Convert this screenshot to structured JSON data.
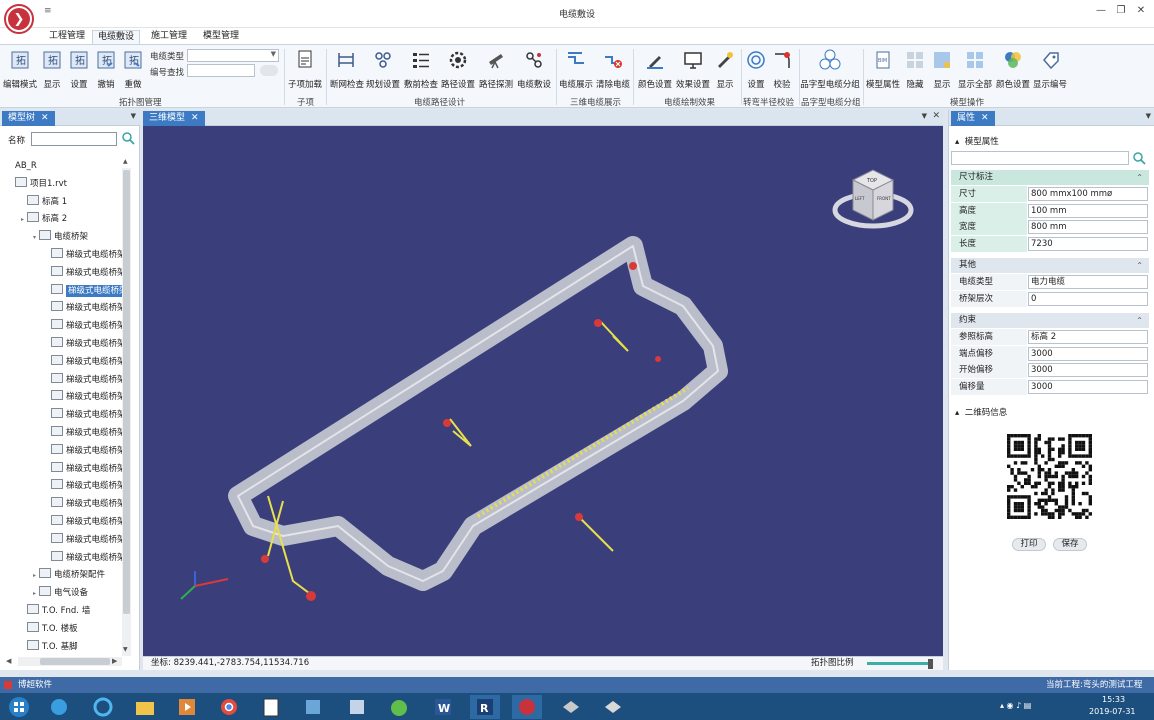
{
  "app": {
    "logo_glyph": "❯",
    "quick_access": "≡",
    "title": "电缆敷设",
    "window_controls": [
      "—",
      "❐",
      "✕"
    ]
  },
  "ribbon_tabs": [
    "工程管理",
    "电缆敷设",
    "施工管理",
    "模型管理"
  ],
  "ribbon": {
    "buttons": [
      {
        "id": "edit-mode",
        "label": "编辑模式",
        "icon": "topology-edit-icon"
      },
      {
        "id": "show",
        "label": "显示",
        "icon": "topology-show-icon"
      },
      {
        "id": "settings",
        "label": "设置",
        "icon": "topology-settings-icon"
      },
      {
        "id": "undo",
        "label": "撤销",
        "icon": "undo-icon"
      },
      {
        "id": "redo",
        "label": "重做",
        "icon": "redo-icon"
      },
      {
        "id": "sub-add",
        "label": "子项加载",
        "icon": "document-icon"
      },
      {
        "id": "break-check",
        "label": "断网检查",
        "icon": "network-break-icon"
      },
      {
        "id": "plan-settings",
        "label": "规划设置",
        "icon": "nodes-icon"
      },
      {
        "id": "lay-check",
        "label": "敷前检查",
        "icon": "checklist-icon"
      },
      {
        "id": "path-settings",
        "label": "路径设置",
        "icon": "path-gear-icon"
      },
      {
        "id": "path-probe",
        "label": "路径探测",
        "icon": "telescope-icon"
      },
      {
        "id": "cable-lay",
        "label": "电缆敷设",
        "icon": "cable-lay-icon"
      },
      {
        "id": "cable-show",
        "label": "电缆展示",
        "icon": "cable-show-icon"
      },
      {
        "id": "clear-cable",
        "label": "清除电缆",
        "icon": "cable-clear-icon"
      },
      {
        "id": "color-settings",
        "label": "颜色设置",
        "icon": "color-pen-icon"
      },
      {
        "id": "effect-settings",
        "label": "效果设置",
        "icon": "monitor-icon"
      },
      {
        "id": "display",
        "label": "显示",
        "icon": "display-pen-icon"
      },
      {
        "id": "bend-settings",
        "label": "设置",
        "icon": "target-icon"
      },
      {
        "id": "bend-verify",
        "label": "校验",
        "icon": "bend-check-icon"
      },
      {
        "id": "pin-cable-group",
        "label": "品字型电缆分组",
        "icon": "abc-group-icon"
      },
      {
        "id": "model-props",
        "label": "模型属性",
        "icon": "bim-icon"
      },
      {
        "id": "hide",
        "label": "隐藏",
        "icon": "hide-icon"
      },
      {
        "id": "model-show",
        "label": "显示",
        "icon": "show-icon"
      },
      {
        "id": "show-all",
        "label": "显示全部",
        "icon": "show-all-icon"
      },
      {
        "id": "model-color",
        "label": "颜色设置",
        "icon": "palette-icon"
      },
      {
        "id": "show-number",
        "label": "显示编号",
        "icon": "number-icon"
      }
    ],
    "cable_type_label": "电缆类型",
    "code_search_label": "编号查找",
    "groups": [
      "拓扑图管理",
      "子项",
      "电缆路径设计",
      "三维电缆展示",
      "电缆绘制效果",
      "转弯半径校验",
      "品字型电缆分组",
      "模型操作"
    ]
  },
  "left_panel": {
    "tab": "模型树",
    "name_label": "名称",
    "tree": [
      {
        "label": "AB_R",
        "level": 0,
        "toggle": "",
        "icon": false
      },
      {
        "label": "项目1.rvt",
        "level": 0,
        "toggle": "",
        "icon": true
      },
      {
        "label": "标高 1",
        "level": 1,
        "toggle": "",
        "icon": true
      },
      {
        "label": "标高 2",
        "level": 1,
        "toggle": "▸",
        "icon": true
      },
      {
        "label": "电缆桥架",
        "level": 2,
        "toggle": "▾",
        "icon": true
      },
      {
        "label": "梯级式电缆桥架",
        "level": 3,
        "toggle": "",
        "icon": true
      },
      {
        "label": "梯级式电缆桥架",
        "level": 3,
        "toggle": "",
        "icon": true
      },
      {
        "label": "梯级式电缆桥架",
        "level": 3,
        "toggle": "",
        "icon": true,
        "selected": true
      },
      {
        "label": "梯级式电缆桥架",
        "level": 3,
        "toggle": "",
        "icon": true
      },
      {
        "label": "梯级式电缆桥架",
        "level": 3,
        "toggle": "",
        "icon": true
      },
      {
        "label": "梯级式电缆桥架",
        "level": 3,
        "toggle": "",
        "icon": true
      },
      {
        "label": "梯级式电缆桥架",
        "level": 3,
        "toggle": "",
        "icon": true
      },
      {
        "label": "梯级式电缆桥架",
        "level": 3,
        "toggle": "",
        "icon": true
      },
      {
        "label": "梯级式电缆桥架",
        "level": 3,
        "toggle": "",
        "icon": true
      },
      {
        "label": "梯级式电缆桥架",
        "level": 3,
        "toggle": "",
        "icon": true
      },
      {
        "label": "梯级式电缆桥架",
        "level": 3,
        "toggle": "",
        "icon": true
      },
      {
        "label": "梯级式电缆桥架",
        "level": 3,
        "toggle": "",
        "icon": true
      },
      {
        "label": "梯级式电缆桥架",
        "level": 3,
        "toggle": "",
        "icon": true
      },
      {
        "label": "梯级式电缆桥架",
        "level": 3,
        "toggle": "",
        "icon": true
      },
      {
        "label": "梯级式电缆桥架",
        "level": 3,
        "toggle": "",
        "icon": true
      },
      {
        "label": "梯级式电缆桥架",
        "level": 3,
        "toggle": "",
        "icon": true
      },
      {
        "label": "梯级式电缆桥架",
        "level": 3,
        "toggle": "",
        "icon": true
      },
      {
        "label": "梯级式电缆桥架",
        "level": 3,
        "toggle": "",
        "icon": true
      },
      {
        "label": "电缆桥架配件",
        "level": 2,
        "toggle": "▸",
        "icon": true
      },
      {
        "label": "电气设备",
        "level": 2,
        "toggle": "▸",
        "icon": true
      },
      {
        "label": "T.O. Fnd. 墙",
        "level": 1,
        "toggle": "",
        "icon": true
      },
      {
        "label": "T.O. 楼板",
        "level": 1,
        "toggle": "",
        "icon": true
      },
      {
        "label": "T.O. 基脚",
        "level": 1,
        "toggle": "",
        "icon": true
      }
    ]
  },
  "viewport": {
    "tab": "三维模型",
    "coords": "坐标: 8239.441,-2783.754,11534.716",
    "scale_label": "拓扑图比例",
    "nav_cube": {
      "top": "TOP",
      "left": "LEFT",
      "front": "FRONT"
    }
  },
  "right_panel": {
    "tab": "属性",
    "model_props_label": "模型属性",
    "sections": [
      {
        "title": "尺寸标注",
        "rows": [
          {
            "key": "尺寸",
            "value": "800 mmx100 mmø"
          },
          {
            "key": "高度",
            "value": "100 mm"
          },
          {
            "key": "宽度",
            "value": "800 mm"
          },
          {
            "key": "长度",
            "value": "7230"
          }
        ]
      },
      {
        "title": "其他",
        "rows": [
          {
            "key": "电缆类型",
            "value": "电力电缆"
          },
          {
            "key": "桥架层次",
            "value": "0"
          }
        ]
      },
      {
        "title": "约束",
        "rows": [
          {
            "key": "参照标高",
            "value": "标高 2"
          },
          {
            "key": "端点偏移",
            "value": "3000"
          },
          {
            "key": "开始偏移",
            "value": "3000"
          },
          {
            "key": "偏移量",
            "value": "3000"
          }
        ]
      }
    ],
    "qr_label": "二维码信息",
    "print_label": "打印",
    "save_label": "保存"
  },
  "status": {
    "app_name": "博超软件",
    "project": "当前工程:弯头的测试工程"
  },
  "taskbar": {
    "time": "15:33",
    "date": "2019-07-31"
  }
}
